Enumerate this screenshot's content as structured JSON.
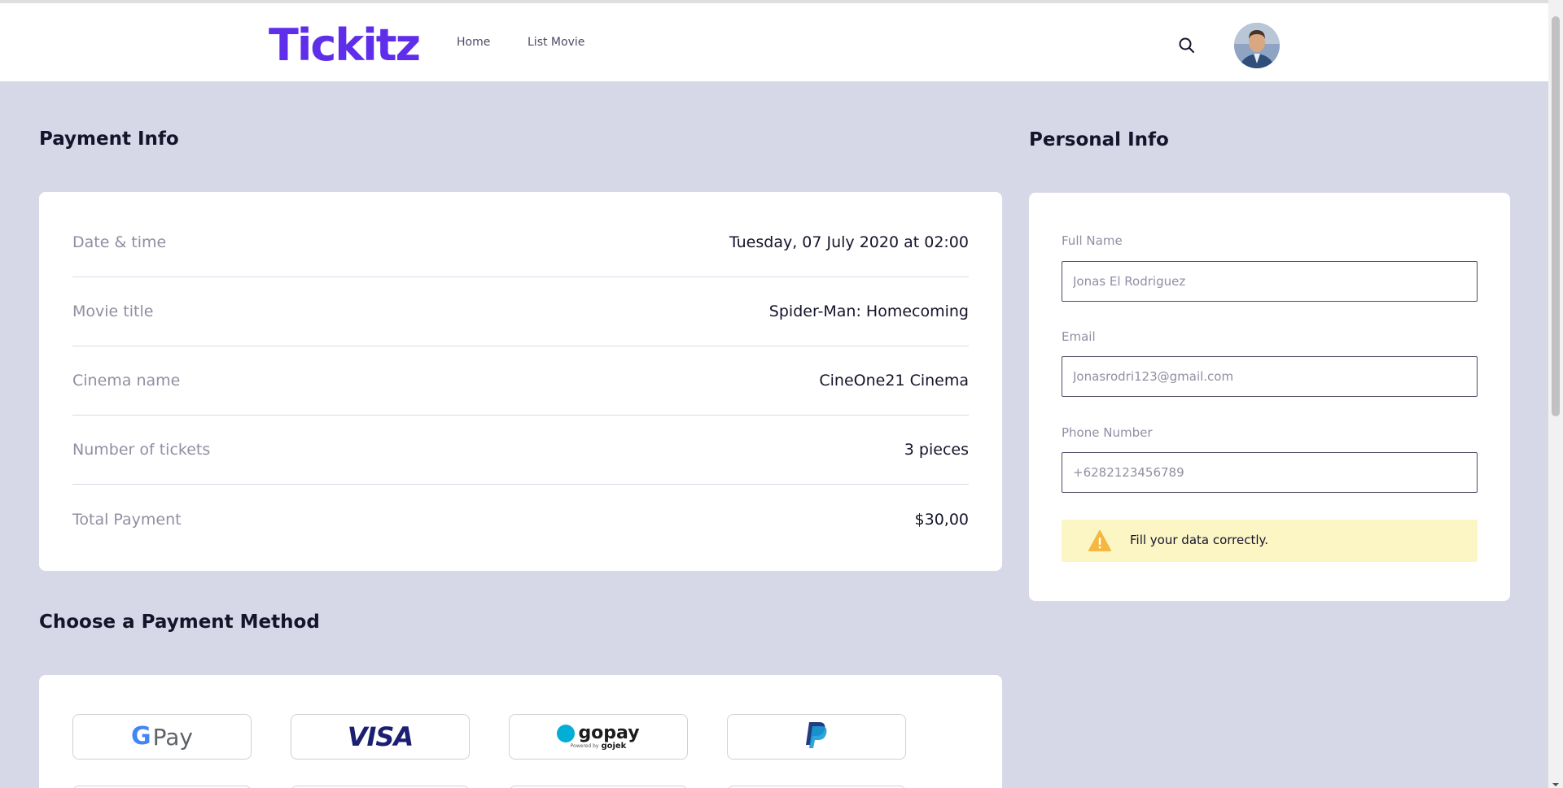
{
  "header": {
    "logo": "Tickitz",
    "nav": [
      {
        "label": "Home"
      },
      {
        "label": "List Movie"
      }
    ]
  },
  "payment_info": {
    "title": "Payment Info",
    "rows": [
      {
        "label": "Date & time",
        "value": "Tuesday, 07 July 2020 at 02:00"
      },
      {
        "label": "Movie title",
        "value": "Spider-Man: Homecoming"
      },
      {
        "label": "Cinema name",
        "value": "CineOne21 Cinema"
      },
      {
        "label": "Number of tickets",
        "value": "3 pieces"
      },
      {
        "label": "Total Payment",
        "value": "$30,00"
      }
    ]
  },
  "personal_info": {
    "title": "Personal Info",
    "full_name": {
      "label": "Full Name",
      "placeholder": "Jonas El Rodriguez"
    },
    "email": {
      "label": "Email",
      "placeholder": "Jonasrodri123@gmail.com"
    },
    "phone": {
      "label": "Phone Number",
      "placeholder": "+6282123456789"
    },
    "alert": "Fill your data correctly."
  },
  "payment_method": {
    "title": "Choose a Payment Method",
    "methods": [
      {
        "name": "google-pay",
        "label": "Pay"
      },
      {
        "name": "visa",
        "label": "VISA"
      },
      {
        "name": "gopay",
        "label": "gopay",
        "sub": "Powered by",
        "sub_brand": "gojek"
      },
      {
        "name": "paypal",
        "label": ""
      }
    ]
  },
  "colors": {
    "brand": "#5f2eea",
    "background": "#d6d8e7",
    "alert_bg": "#fcf5c4",
    "warning": "#f4b740"
  }
}
